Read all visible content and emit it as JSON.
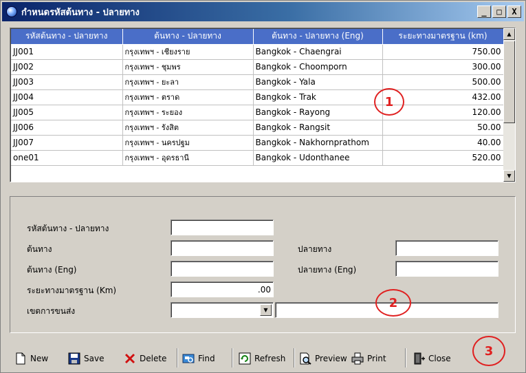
{
  "window": {
    "title": "กำหนดรหัสต้นทาง - ปลายทาง",
    "min_label": "_",
    "max_label": "□",
    "close_label": "X"
  },
  "grid": {
    "columns": [
      "รหัสต้นทาง - ปลายทาง",
      "ต้นทาง - ปลายทาง",
      "ต้นทาง - ปลายทาง (Eng)",
      "ระยะทางมาตรฐาน (km)"
    ],
    "rows": [
      {
        "code": "JJ001",
        "route_th": "กรุงเทพฯ - เชียงราย",
        "route_en": "Bangkok - Chaengrai",
        "distance": "750.00"
      },
      {
        "code": "JJ002",
        "route_th": "กรุงเทพฯ - ชุมพร",
        "route_en": "Bangkok - Choomporn",
        "distance": "300.00"
      },
      {
        "code": "JJ003",
        "route_th": "กรุงเทพฯ - ยะลา",
        "route_en": "Bangkok - Yala",
        "distance": "500.00"
      },
      {
        "code": "JJ004",
        "route_th": "กรุงเทพฯ - ตราด",
        "route_en": "Bangkok - Trak",
        "distance": "432.00"
      },
      {
        "code": "JJ005",
        "route_th": "กรุงเทพฯ - ระยอง",
        "route_en": "Bangkok - Rayong",
        "distance": "120.00"
      },
      {
        "code": "JJ006",
        "route_th": "กรุงเทพฯ - รังสิต",
        "route_en": "Bangkok - Rangsit",
        "distance": "50.00"
      },
      {
        "code": "JJ007",
        "route_th": "กรุงเทพฯ - นครปฐม",
        "route_en": "Bangkok - Nakhornprathom",
        "distance": "40.00"
      },
      {
        "code": "one01",
        "route_th": "กรุงเทพฯ - อุดรธานี",
        "route_en": "Bangkok - Udonthanee",
        "distance": "520.00"
      }
    ]
  },
  "form": {
    "code_label": "รหัสต้นทาง - ปลายทาง",
    "origin_label": "ต้นทาง",
    "destination_label": "ปลายทาง",
    "origin_en_label": "ต้นทาง (Eng)",
    "destination_en_label": "ปลายทาง (Eng)",
    "distance_label": "ระยะทางมาตรฐาน (Km)",
    "distance_value": ".00",
    "zone_label": "เขตการขนส่ง"
  },
  "toolbar": {
    "new": "New",
    "save": "Save",
    "delete": "Delete",
    "find": "Find",
    "refresh": "Refresh",
    "preview": "Preview",
    "print": "Print",
    "close": "Close"
  },
  "markers": {
    "m1": "1",
    "m2": "2",
    "m3": "3"
  },
  "colors": {
    "title_start": "#0a246a",
    "header_bg": "#4a6ec8",
    "marker": "#e02020"
  },
  "icons": [
    "globe-icon",
    "new-document-icon",
    "save-disk-icon",
    "delete-x-icon",
    "find-icon",
    "refresh-icon",
    "preview-icon",
    "print-icon",
    "close-door-icon"
  ]
}
